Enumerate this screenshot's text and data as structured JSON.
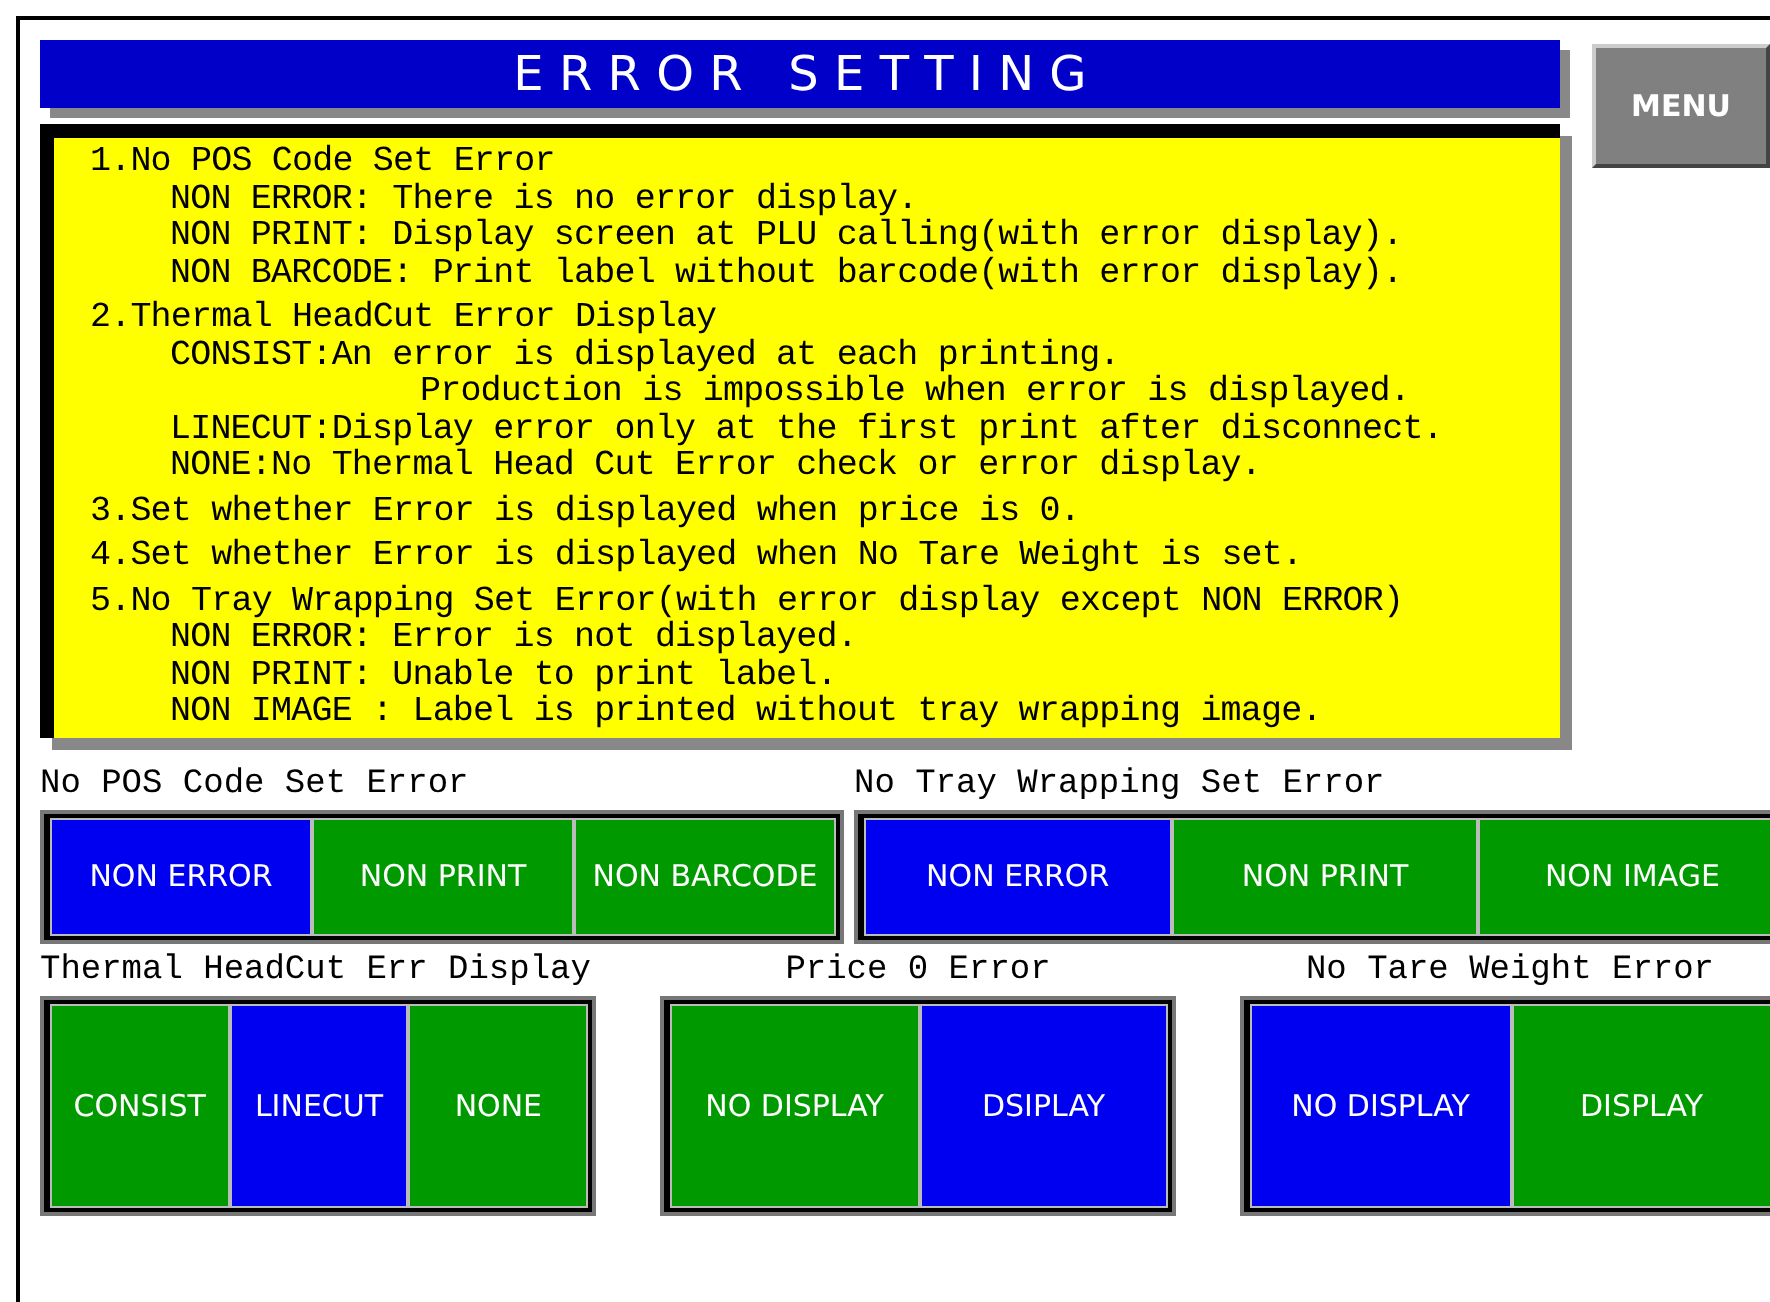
{
  "title": "E R R O R   S E T T I N G",
  "menu_button": "MENU",
  "help": [
    {
      "number": "1.",
      "title": "No POS Code Set Error",
      "lines": [
        {
          "kind": "detail",
          "text": "NON ERROR: There is no error display."
        },
        {
          "kind": "detail",
          "text": "NON PRINT: Display screen at PLU calling(with error display)."
        },
        {
          "kind": "detail",
          "text": "NON BARCODE: Print label without barcode(with error display)."
        }
      ]
    },
    {
      "number": "2.",
      "title": "Thermal HeadCut Error Display",
      "lines": [
        {
          "kind": "detail",
          "text": "CONSIST:An error is displayed at each printing."
        },
        {
          "kind": "continuation",
          "text": "Production is impossible when error is displayed."
        },
        {
          "kind": "detail",
          "text": "LINECUT:Display error only at the first print after disconnect."
        },
        {
          "kind": "detail",
          "text": "NONE:No Thermal Head Cut Error check or error display."
        }
      ]
    },
    {
      "number": "3.",
      "title": "Set whether Error is displayed when price is 0."
    },
    {
      "number": "4.",
      "title": "Set whether Error is displayed when No Tare Weight is set."
    },
    {
      "number": "5.",
      "title": "No Tray Wrapping Set Error(with error display except NON ERROR)",
      "lines": [
        {
          "kind": "detail",
          "text": "NON ERROR: Error is not displayed."
        },
        {
          "kind": "detail",
          "text": "NON PRINT: Unable to print label."
        },
        {
          "kind": "detail",
          "text": "NON IMAGE : Label is printed without tray wrapping image."
        }
      ]
    }
  ],
  "setting_rows": [
    [
      {
        "label": "No POS Code Set Error",
        "options": [
          {
            "label": "NON ERROR",
            "selected": true
          },
          {
            "label": "NON PRINT",
            "selected": false
          },
          {
            "label": "NON BARCODE",
            "selected": false
          }
        ]
      },
      {
        "label": "No Tray Wrapping Set Error",
        "options": [
          {
            "label": "NON ERROR",
            "selected": true
          },
          {
            "label": "NON PRINT",
            "selected": false
          },
          {
            "label": "NON IMAGE",
            "selected": false
          }
        ]
      }
    ],
    [
      {
        "label": "Thermal HeadCut Err Display",
        "options": [
          {
            "label": "CONSIST",
            "selected": false
          },
          {
            "label": "LINECUT",
            "selected": true
          },
          {
            "label": "NONE",
            "selected": false
          }
        ]
      },
      {
        "label": "Price 0 Error",
        "options": [
          {
            "label": "NO DISPLAY",
            "selected": false
          },
          {
            "label": "DSIPLAY",
            "selected": true
          }
        ]
      },
      {
        "label": "No Tare Weight Error",
        "options": [
          {
            "label": "NO DISPLAY",
            "selected": true
          },
          {
            "label": "DISPLAY",
            "selected": false
          }
        ]
      }
    ]
  ]
}
